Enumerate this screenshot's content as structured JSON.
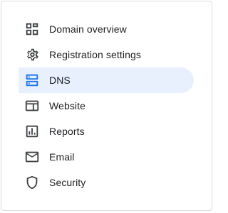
{
  "nav": {
    "items": [
      {
        "label": "Domain overview",
        "icon": "dashboard-icon"
      },
      {
        "label": "Registration settings",
        "icon": "gear-icon"
      },
      {
        "label": "DNS",
        "icon": "dns-icon",
        "active": true
      },
      {
        "label": "Website",
        "icon": "web-icon"
      },
      {
        "label": "Reports",
        "icon": "bar-chart-icon"
      },
      {
        "label": "Email",
        "icon": "mail-icon"
      },
      {
        "label": "Security",
        "icon": "shield-icon"
      }
    ]
  },
  "colors": {
    "active_bg": "#e8f0fe",
    "active_icon": "#1a73e8",
    "icon": "#3c4043",
    "text": "#202124"
  }
}
